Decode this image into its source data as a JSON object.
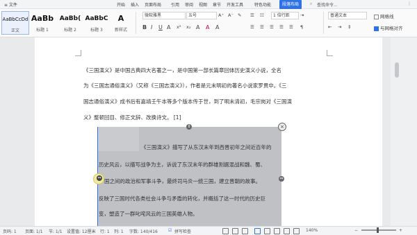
{
  "menu": {
    "items": [
      "≡ 文件",
      "开始",
      "插入",
      "页面布局",
      "引用",
      "审阅",
      "视图",
      "章节",
      "开发工具",
      "特色功能"
    ],
    "active_tab": "段落布局",
    "search_placeholder": "查找命令..."
  },
  "styles": [
    {
      "sample": "AaBbCcDd",
      "name": "正文"
    },
    {
      "sample": "AaBb",
      "name": "标题 1"
    },
    {
      "sample": "AaBb(",
      "name": "标题 2"
    },
    {
      "sample": "AaBbC",
      "name": "标题 3"
    },
    {
      "sample": "A",
      "name": "新样式"
    }
  ],
  "ribbon": {
    "font_name": "微软雅黑",
    "font_size": "五号",
    "line_spacing": "1 倍行距",
    "style_set": "普通文本",
    "grid_lines": "网格线",
    "align_to_grid": "与网格对齐"
  },
  "document": {
    "paragraph1": [
      "《三国演义》是中国古典四大名著之一，是中国第一部长篇章回体历史演义小说，全名",
      "为《三国志通俗演义》（又称《三国志演义》），作者是元末明初的著名小说家罗贯中。《三",
      "国志通俗演义》成书后有嘉靖壬午本等多个版本传于世，到了明末清初，毛宗岗对《三国演",
      "义》整顿回目、修正文辞、改换诗文。 [1]"
    ],
    "selected_paragraph": [
      "《三国演义》描写了从东汉末年到西晋初年之间近百年的",
      "历史风云，以描写战争为主，诉说了东汉末年的群雄割据混战和魏、蜀、",
      "国之间的政治和军事斗争，最终司马炎一统三国，建立晋朝的故事。",
      "反映了三国时代各类社会斗争与矛盾的转化，并概括了这一时代的历史巨",
      "变，塑造了一群叱咤风云的三国英雄人物。"
    ]
  },
  "status": {
    "page": "页码: 1",
    "pages": "页面: 1/1",
    "section": "节: 1/1",
    "setting": "设置值: 12厘米",
    "row": "行: 1",
    "col": "列: 1",
    "words": "字数: 140/416",
    "spellcheck": "拼写检查",
    "zoom": "140%"
  }
}
